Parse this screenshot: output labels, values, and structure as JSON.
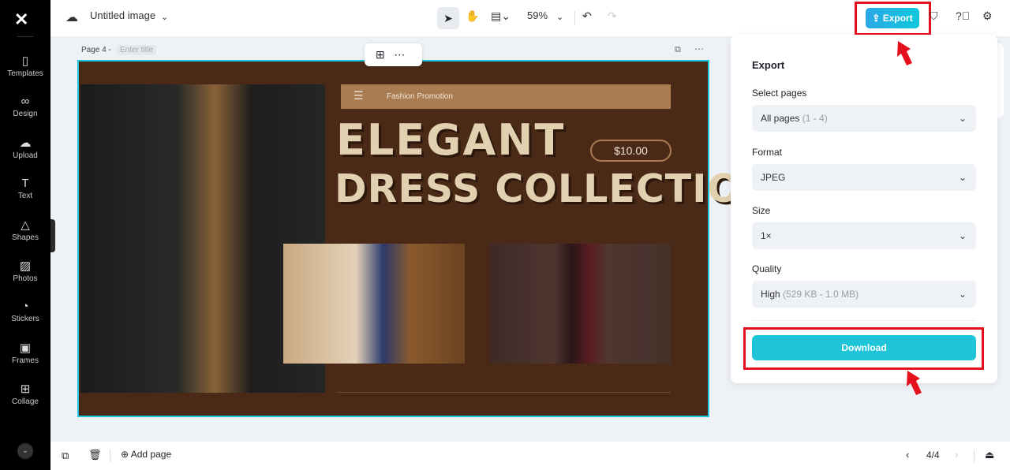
{
  "sidebar": {
    "items": [
      {
        "label": "Templates",
        "icon": "templates-icon"
      },
      {
        "label": "Design",
        "icon": "design-icon"
      },
      {
        "label": "Upload",
        "icon": "upload-icon"
      },
      {
        "label": "Text",
        "icon": "text-icon"
      },
      {
        "label": "Shapes",
        "icon": "shapes-icon"
      },
      {
        "label": "Photos",
        "icon": "photos-icon"
      },
      {
        "label": "Stickers",
        "icon": "stickers-icon"
      },
      {
        "label": "Frames",
        "icon": "frames-icon"
      },
      {
        "label": "Collage",
        "icon": "collage-icon"
      }
    ]
  },
  "topbar": {
    "title": "Untitled image",
    "zoom": "59%",
    "export_label": "Export"
  },
  "page": {
    "label": "Page 4 -",
    "title_placeholder": "Enter title"
  },
  "design": {
    "banner": "Fashion Promotion",
    "headline1": "ELEGANT",
    "headline2": "DRESS COLLECTION",
    "price": "$10.00"
  },
  "export": {
    "title": "Export",
    "select_pages_label": "Select pages",
    "select_pages_value": "All pages",
    "select_pages_range": "(1 - 4)",
    "format_label": "Format",
    "format_value": "JPEG",
    "size_label": "Size",
    "size_value": "1×",
    "quality_label": "Quality",
    "quality_value": "High",
    "quality_range": "(529 KB - 1.0 MB)",
    "download_label": "Download"
  },
  "bottombar": {
    "add_page": "Add page",
    "page_counter": "4/4"
  },
  "colors": {
    "accent": "#1ec4d8",
    "canvas_bg": "#4a2a17",
    "highlight": "#e5101e"
  }
}
